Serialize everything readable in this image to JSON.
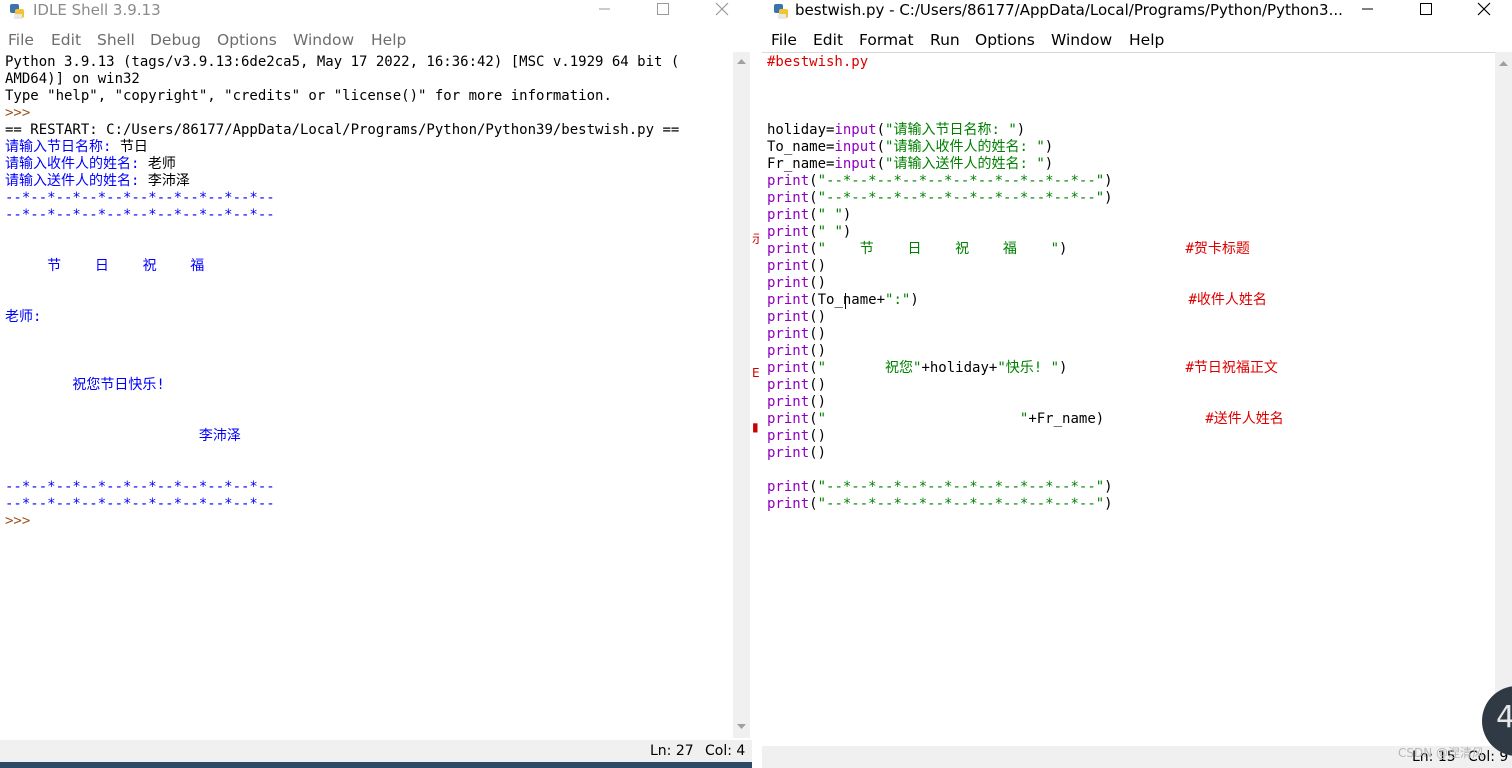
{
  "shell": {
    "title": "IDLE Shell 3.9.13",
    "menu": [
      "File",
      "Edit",
      "Shell",
      "Debug",
      "Options",
      "Window",
      "Help"
    ],
    "lines": [
      {
        "text": "Python 3.9.13 (tags/v3.9.13:6de2ca5, May 17 2022, 16:36:42) [MSC v.1929 64 bit (",
        "color": "blk"
      },
      {
        "text": "AMD64)] on win32",
        "color": "blk"
      },
      {
        "text": "Type \"help\", \"copyright\", \"credits\" or \"license()\" for more information.",
        "color": "blk"
      },
      {
        "text": ">>>",
        "color": "brn"
      },
      {
        "text": "== RESTART: C:/Users/86177/AppData/Local/Programs/Python/Python39/bestwish.py ==",
        "color": "blk"
      },
      {
        "text": "请输入节日名称: ",
        "color": "blue",
        "input": "节日"
      },
      {
        "text": "请输入收件人的姓名: ",
        "color": "blue",
        "input": "老师"
      },
      {
        "text": "请输入送件人的姓名: ",
        "color": "blue",
        "input": "李沛泽"
      },
      {
        "text": "--*--*--*--*--*--*--*--*--*--*--",
        "color": "blue"
      },
      {
        "text": "--*--*--*--*--*--*--*--*--*--*--",
        "color": "blue"
      },
      {
        "text": "",
        "color": "blue"
      },
      {
        "text": "",
        "color": "blue"
      },
      {
        "text": "     节    日    祝    福",
        "color": "blue"
      },
      {
        "text": "",
        "color": "blue"
      },
      {
        "text": "",
        "color": "blue"
      },
      {
        "text": "老师:",
        "color": "blue"
      },
      {
        "text": "",
        "color": "blue"
      },
      {
        "text": "",
        "color": "blue"
      },
      {
        "text": "",
        "color": "blue"
      },
      {
        "text": "        祝您节日快乐!",
        "color": "blue"
      },
      {
        "text": "",
        "color": "blue"
      },
      {
        "text": "",
        "color": "blue"
      },
      {
        "text": "                       李沛泽",
        "color": "blue"
      },
      {
        "text": "",
        "color": "blue"
      },
      {
        "text": "",
        "color": "blue"
      },
      {
        "text": "--*--*--*--*--*--*--*--*--*--*--",
        "color": "blue"
      },
      {
        "text": "--*--*--*--*--*--*--*--*--*--*--",
        "color": "blue"
      },
      {
        "text": ">>>",
        "color": "brn"
      }
    ],
    "status_ln": "Ln: 27",
    "status_col": "Col: 4"
  },
  "editor": {
    "title": "bestwish.py - C:/Users/86177/AppData/Local/Programs/Python/Python3...",
    "menu": [
      "File",
      "Edit",
      "Format",
      "Run",
      "Options",
      "Window",
      "Help"
    ],
    "lines": [
      [
        {
          "t": "#bestwish.py",
          "c": "red"
        }
      ],
      [],
      [],
      [],
      [
        {
          "t": "holiday=",
          "c": "blk"
        },
        {
          "t": "input",
          "c": "pur"
        },
        {
          "t": "(",
          "c": "blk"
        },
        {
          "t": "\"请输入节日名称: \"",
          "c": "grn"
        },
        {
          "t": ")",
          "c": "blk"
        }
      ],
      [
        {
          "t": "To_name=",
          "c": "blk"
        },
        {
          "t": "input",
          "c": "pur"
        },
        {
          "t": "(",
          "c": "blk"
        },
        {
          "t": "\"请输入收件人的姓名: \"",
          "c": "grn"
        },
        {
          "t": ")",
          "c": "blk"
        }
      ],
      [
        {
          "t": "Fr_name=",
          "c": "blk"
        },
        {
          "t": "input",
          "c": "pur"
        },
        {
          "t": "(",
          "c": "blk"
        },
        {
          "t": "\"请输入送件人的姓名: \"",
          "c": "grn"
        },
        {
          "t": ")",
          "c": "blk"
        }
      ],
      [
        {
          "t": "print",
          "c": "pur"
        },
        {
          "t": "(",
          "c": "blk"
        },
        {
          "t": "\"--*--*--*--*--*--*--*--*--*--*--\"",
          "c": "grn"
        },
        {
          "t": ")",
          "c": "blk"
        }
      ],
      [
        {
          "t": "print",
          "c": "pur"
        },
        {
          "t": "(",
          "c": "blk"
        },
        {
          "t": "\"--*--*--*--*--*--*--*--*--*--*--\"",
          "c": "grn"
        },
        {
          "t": ")",
          "c": "blk"
        }
      ],
      [
        {
          "t": "print",
          "c": "pur"
        },
        {
          "t": "(",
          "c": "blk"
        },
        {
          "t": "\" \"",
          "c": "grn"
        },
        {
          "t": ")",
          "c": "blk"
        }
      ],
      [
        {
          "t": "print",
          "c": "pur"
        },
        {
          "t": "(",
          "c": "blk"
        },
        {
          "t": "\" \"",
          "c": "grn"
        },
        {
          "t": ")",
          "c": "blk"
        }
      ],
      [
        {
          "t": "print",
          "c": "pur"
        },
        {
          "t": "(",
          "c": "blk"
        },
        {
          "t": "\"    节    日    祝    福    \"",
          "c": "grn"
        },
        {
          "t": ")",
          "c": "blk"
        },
        {
          "t": "              ",
          "c": "blk"
        },
        {
          "t": "#贺卡标题",
          "c": "red"
        }
      ],
      [
        {
          "t": "print",
          "c": "pur"
        },
        {
          "t": "()",
          "c": "blk"
        }
      ],
      [
        {
          "t": "print",
          "c": "pur"
        },
        {
          "t": "()",
          "c": "blk"
        }
      ],
      [
        {
          "t": "print",
          "c": "pur"
        },
        {
          "t": "(To_name+",
          "c": "blk"
        },
        {
          "t": "\":\"",
          "c": "grn"
        },
        {
          "t": ")",
          "c": "blk"
        },
        {
          "t": "                                ",
          "c": "blk"
        },
        {
          "t": "#收件人姓名",
          "c": "red"
        }
      ],
      [
        {
          "t": "print",
          "c": "pur"
        },
        {
          "t": "()",
          "c": "blk"
        }
      ],
      [
        {
          "t": "print",
          "c": "pur"
        },
        {
          "t": "()",
          "c": "blk"
        }
      ],
      [
        {
          "t": "print",
          "c": "pur"
        },
        {
          "t": "()",
          "c": "blk"
        }
      ],
      [
        {
          "t": "print",
          "c": "pur"
        },
        {
          "t": "(",
          "c": "blk"
        },
        {
          "t": "\"       祝您\"",
          "c": "grn"
        },
        {
          "t": "+holiday+",
          "c": "blk"
        },
        {
          "t": "\"快乐! \"",
          "c": "grn"
        },
        {
          "t": ")",
          "c": "blk"
        },
        {
          "t": "              ",
          "c": "blk"
        },
        {
          "t": "#节日祝福正文",
          "c": "red"
        }
      ],
      [
        {
          "t": "print",
          "c": "pur"
        },
        {
          "t": "()",
          "c": "blk"
        }
      ],
      [
        {
          "t": "print",
          "c": "pur"
        },
        {
          "t": "()",
          "c": "blk"
        }
      ],
      [
        {
          "t": "print",
          "c": "pur"
        },
        {
          "t": "(",
          "c": "blk"
        },
        {
          "t": "\"                       \"",
          "c": "grn"
        },
        {
          "t": "+Fr_name)",
          "c": "blk"
        },
        {
          "t": "            ",
          "c": "blk"
        },
        {
          "t": "#送件人姓名",
          "c": "red"
        }
      ],
      [
        {
          "t": "print",
          "c": "pur"
        },
        {
          "t": "()",
          "c": "blk"
        }
      ],
      [
        {
          "t": "print",
          "c": "pur"
        },
        {
          "t": "()",
          "c": "blk"
        }
      ],
      [],
      [
        {
          "t": "print",
          "c": "pur"
        },
        {
          "t": "(",
          "c": "blk"
        },
        {
          "t": "\"--*--*--*--*--*--*--*--*--*--*--\"",
          "c": "grn"
        },
        {
          "t": ")",
          "c": "blk"
        }
      ],
      [
        {
          "t": "print",
          "c": "pur"
        },
        {
          "t": "(",
          "c": "blk"
        },
        {
          "t": "\"--*--*--*--*--*--*--*--*--*--*--\"",
          "c": "grn"
        },
        {
          "t": ")",
          "c": "blk"
        }
      ]
    ],
    "status_ln": "Ln: 15",
    "status_col": "Col: 9"
  },
  "overlay_number": "4",
  "watermark": "CSDN @涅清风"
}
